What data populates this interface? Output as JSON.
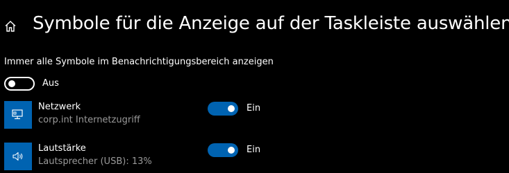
{
  "header": {
    "title": "Symbole für die Anzeige auf der Taskleiste auswählen",
    "home_icon": "home-icon"
  },
  "always_show": {
    "label": "Immer alle Symbole im Benachrichtigungsbereich anzeigen",
    "state": "Aus",
    "on": false
  },
  "apps": [
    {
      "name": "Netzwerk",
      "subtitle": "corp.int Internetzugriff",
      "icon": "network-icon",
      "state": "Ein",
      "on": true
    },
    {
      "name": "Lautstärke",
      "subtitle": "Lautsprecher (USB): 13%",
      "icon": "volume-icon",
      "state": "Ein",
      "on": true
    }
  ],
  "colors": {
    "accent": "#0063b1",
    "background": "#000000",
    "text": "#ffffff",
    "secondary_text": "#9a9a9a"
  }
}
